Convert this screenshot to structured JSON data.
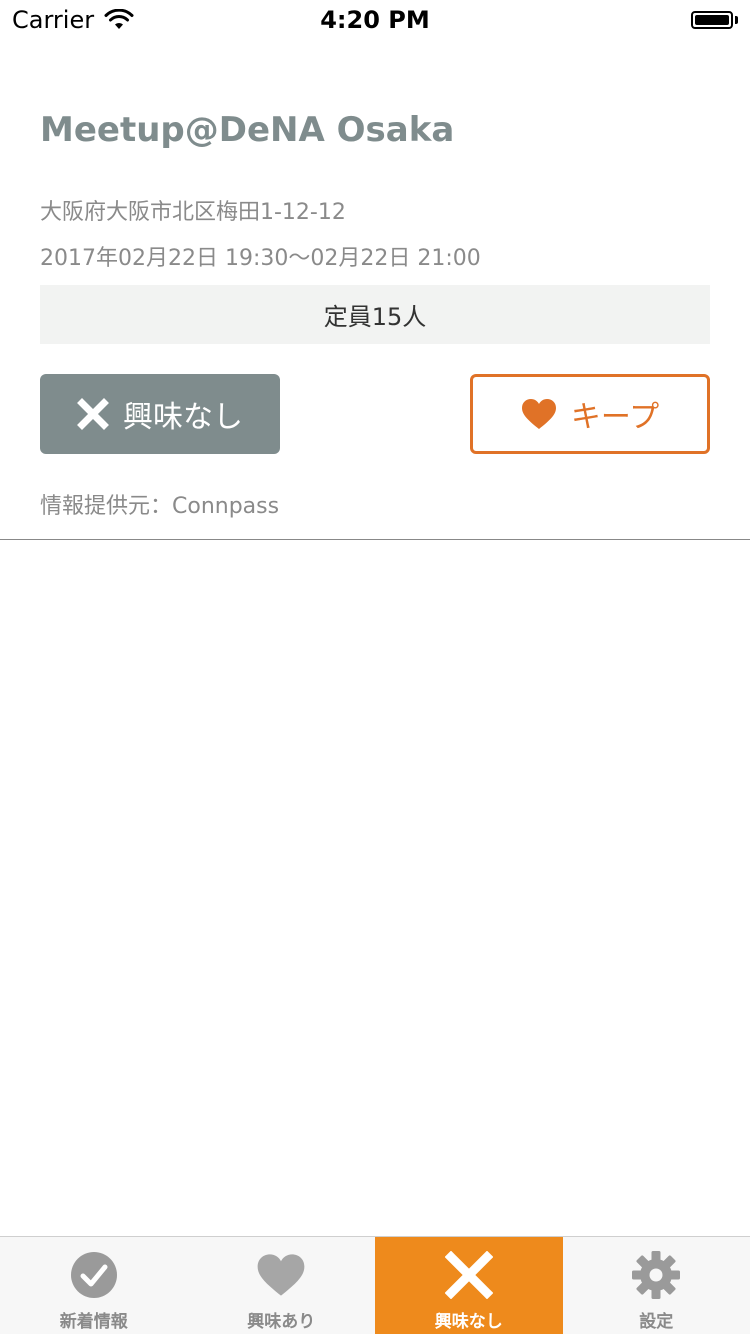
{
  "status_bar": {
    "carrier": "Carrier",
    "time": "4:20 PM"
  },
  "event": {
    "title": "Meetup@DeNA Osaka",
    "address": "大阪府大阪市北区梅田1-12-12",
    "datetime": "2017年02月22日 19:30〜02月22日 21:00",
    "capacity": "定員15人",
    "dismiss_label": "興味なし",
    "keep_label": "キープ",
    "source": "情報提供元：Connpass"
  },
  "tabs": [
    {
      "label": "新着情報",
      "icon": "checkmark-circle-icon",
      "active": false
    },
    {
      "label": "興味あり",
      "icon": "heart-icon",
      "active": false
    },
    {
      "label": "興味なし",
      "icon": "x-icon",
      "active": true
    },
    {
      "label": "設定",
      "icon": "gear-icon",
      "active": false
    }
  ],
  "colors": {
    "accent": "#ee8a1c",
    "keep": "#e07227",
    "dismiss": "#7f8c8d",
    "inactive_tab": "#8a8a8a"
  }
}
